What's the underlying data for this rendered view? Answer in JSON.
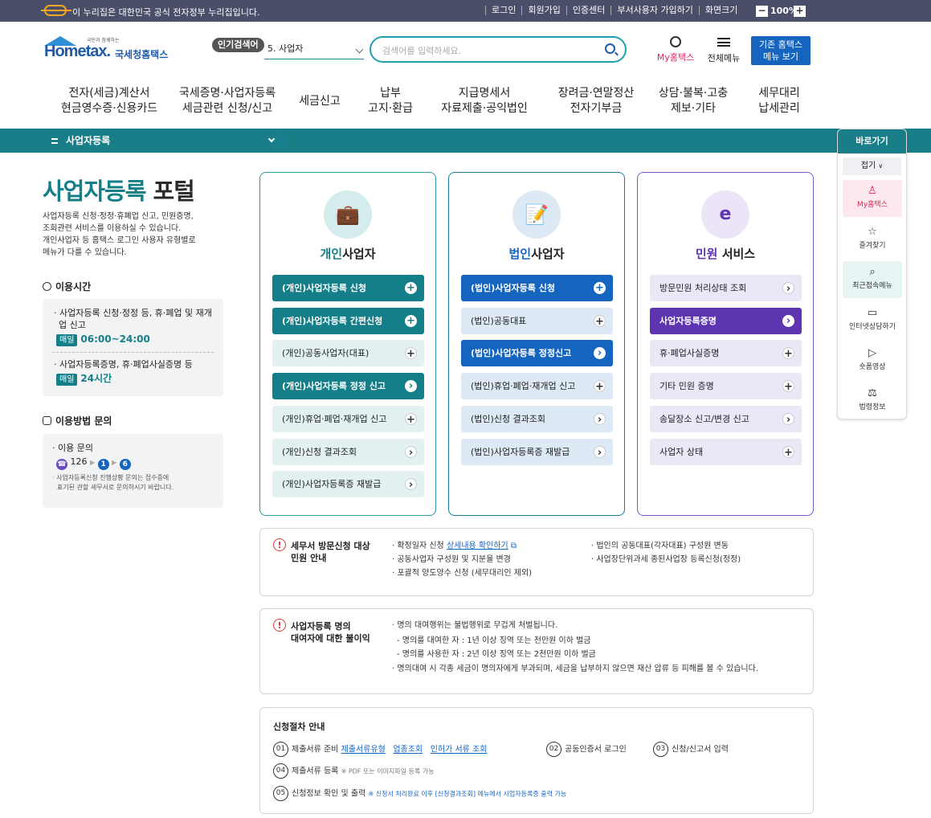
{
  "gov": {
    "message": "이 누리집은 대한민국 공식 전자정부 누리집입니다.",
    "links": [
      "로그인",
      "회원가입",
      "인증센터",
      "부서사용자 가입하기",
      "화면크기"
    ],
    "zoom": "100%"
  },
  "header": {
    "logo_small": "국민과 함께하는",
    "logo_text": "Hometax.",
    "logo_ko": "국세청홈택스",
    "popular_label": "인기검색어",
    "popular_value": "5.  사업자",
    "search_placeholder": "검색어를 입력하세요.",
    "my_hometax": "My홈택스",
    "all_menu": "전체메뉴",
    "old_hometax": [
      "기존 홈택스",
      "메뉴 보기"
    ]
  },
  "gnb": [
    [
      "전자(세금)계산서",
      "현금영수증·신용카드"
    ],
    [
      "국세증명·사업자등록",
      "세금관련 신청/신고"
    ],
    [
      "세금신고"
    ],
    [
      "납부",
      "고지·환급"
    ],
    [
      "지급명세서",
      "자료제출·공익법인"
    ],
    [
      "장려금·연말정산",
      "전자기부금"
    ],
    [
      "상담·불복·고충",
      "제보·기타"
    ],
    [
      "세무대리",
      "납세관리"
    ]
  ],
  "subnav": {
    "current": "사업자등록"
  },
  "left": {
    "title_hl": "사업자등록",
    "title_rest": " 포털",
    "desc": [
      "사업자등록 신청·정정·휴폐업 신고, 민원증명,",
      "조회관련 서비스를 이용하실 수 있습니다.",
      "개인사업자 등 홈택스 로그인 사용자 유형별로",
      "메뉴가 다를 수 있습니다."
    ],
    "hours_title": "이용시간",
    "hours": [
      {
        "text": "사업자등록 신청·정정 등, 휴·폐업 및 재개업 신고",
        "badge": "매일",
        "time": "06:00~24:00"
      },
      {
        "text": "사업자등록증명, 휴·폐업사실증명 등",
        "badge": "매일",
        "time": "24시간"
      }
    ],
    "inquiry_title": "이용방법 문의",
    "inquiry_label": "이용 문의",
    "inquiry_phone": "126",
    "inquiry_steps": [
      "1",
      "6"
    ],
    "inquiry_note": [
      "사업자등록신청 진행상황 문의는 접수증에",
      "표기된 관할 세무서로 문의하시기 바랍니다."
    ]
  },
  "cards": [
    {
      "title_hl": "개인",
      "title_rest": "사업자",
      "items": [
        {
          "label": "(개인)사업자등록 신청",
          "type": "plus",
          "style": "teal"
        },
        {
          "label": "(개인)사업자등록 간편신청",
          "type": "plus",
          "style": "teal"
        },
        {
          "label": "(개인)공동사업자(대표)",
          "type": "plus",
          "style": "light"
        },
        {
          "label": "(개인)사업자등록 정정 신고",
          "type": "arrow",
          "style": "teal"
        },
        {
          "label": "(개인)휴업·폐업·재개업 신고",
          "type": "plus",
          "style": "light"
        },
        {
          "label": "(개인)신청 결과조회",
          "type": "arrow",
          "style": "light"
        },
        {
          "label": "(개인)사업자등록증 재발급",
          "type": "arrow",
          "style": "light"
        }
      ]
    },
    {
      "title_hl": "법인",
      "title_rest": "사업자",
      "items": [
        {
          "label": "(법인)사업자등록 신청",
          "type": "plus",
          "style": "blue"
        },
        {
          "label": "(법인)공동대표",
          "type": "plus",
          "style": "lightblue"
        },
        {
          "label": "(법인)사업자등록 정정신고",
          "type": "arrow",
          "style": "blue"
        },
        {
          "label": "(법인)휴업·폐업·재개업 신고",
          "type": "plus",
          "style": "lightblue"
        },
        {
          "label": "(법인)신청 결과조회",
          "type": "arrow",
          "style": "lightblue"
        },
        {
          "label": "(법인)사업자등록증 재발급",
          "type": "arrow",
          "style": "lightblue"
        }
      ]
    },
    {
      "title_hl": "민원",
      "title_rest": " 서비스",
      "items": [
        {
          "label": "방문민원 처리상태 조회",
          "type": "arrow",
          "style": "lav"
        },
        {
          "label": "사업자등록증명",
          "type": "arrow",
          "style": "purple"
        },
        {
          "label": "휴·폐업사실증명",
          "type": "plus",
          "style": "lav"
        },
        {
          "label": "기타 민원 증명",
          "type": "plus",
          "style": "lav"
        },
        {
          "label": "송달장소 신고/변경 신고",
          "type": "arrow",
          "style": "lav"
        },
        {
          "label": "사업자 상태",
          "type": "plus",
          "style": "lav"
        }
      ]
    }
  ],
  "notice1": {
    "title": [
      "세무서 방문신청 대상",
      "민원 안내"
    ],
    "col1": [
      "확정일자 신청",
      "공동사업자 구성원 및 지분율 변경",
      "포괄적 양도양수 신청 (세무대리인 제외)"
    ],
    "col1_link": "상세내용 확인하기",
    "col2": [
      "법인의 공동대표(각자대표) 구성원 변동",
      "사업장단위과세 종된사업장 등록신청(정정)"
    ]
  },
  "notice2": {
    "title": [
      "사업자등록 명의",
      "대여자에 대한 불이익"
    ],
    "lines": [
      "명의 대여행위는 불법행위로 무겁게 처벌됩니다.",
      "- 명의를 대여한 자 : 1년 이상 징역 또는 천만원 이하 벌금",
      "- 명의를 사용한 자 : 2년 이상 징역 또는 2천만원 이하 벌금",
      "명의대여 시 각종 세금이 명의자에게 부과되며, 세금을 납부하지 않으면 재산 압류 등 피해를 볼 수 있습니다."
    ]
  },
  "steps": {
    "title": "신청절차 안내",
    "s1": {
      "num": "01",
      "label": "제출서류 준비",
      "links": [
        "제출서류유형",
        "업종조회",
        "인허가 서류 조회"
      ]
    },
    "s2": {
      "num": "02",
      "label": "공동인증서 로그인"
    },
    "s3": {
      "num": "03",
      "label": "신청/신고서 입력"
    },
    "s4": {
      "num": "04",
      "label": "제출서류 등록",
      "note": "※ PDF 또는 이미지파일 등록 가능"
    },
    "s5": {
      "num": "05",
      "label": "신청정보 확인 및 출력",
      "note": "※ 신청서 처리완료 이후 [신청결과조회] 메뉴에서 사업자등록증 출력 가능"
    }
  },
  "quick": {
    "title": "바로가기",
    "fold": "접기",
    "items": [
      "My홈택스",
      "즐겨찾기",
      "최근접속메뉴",
      "인터넷상담하기",
      "숏폼영상",
      "법령정보"
    ]
  },
  "colors": {
    "teal": "#147f88",
    "blue": "#1565c0",
    "purple": "#5e35b1"
  }
}
